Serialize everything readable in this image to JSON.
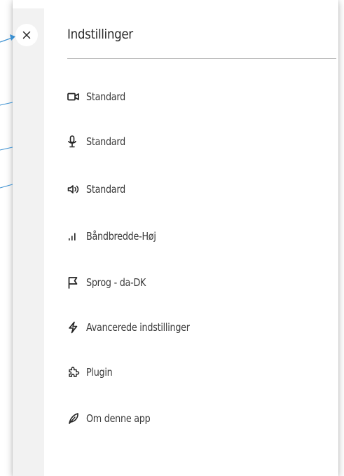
{
  "colors": {
    "annotation": "#3a8fd0",
    "text": "#333333",
    "divider": "#bdbdbd",
    "strip": "#f2f2f2"
  },
  "close_button": {
    "glyph": "×",
    "icon": "close-icon"
  },
  "settings": {
    "title": "Indstillinger",
    "items": [
      {
        "icon": "video-camera-icon",
        "label": "Standard"
      },
      {
        "icon": "microphone-icon",
        "label": "Standard"
      },
      {
        "icon": "speaker-icon",
        "label": "Standard"
      },
      {
        "icon": "signal-bars-icon",
        "label": "Båndbredde-Høj"
      },
      {
        "icon": "flag-icon",
        "label": "Sprog - da-DK"
      },
      {
        "icon": "lightning-icon",
        "label": "Avancerede indstillinger"
      },
      {
        "icon": "puzzle-icon",
        "label": "Plugin"
      },
      {
        "icon": "feather-icon",
        "label": "Om denne app"
      }
    ]
  }
}
